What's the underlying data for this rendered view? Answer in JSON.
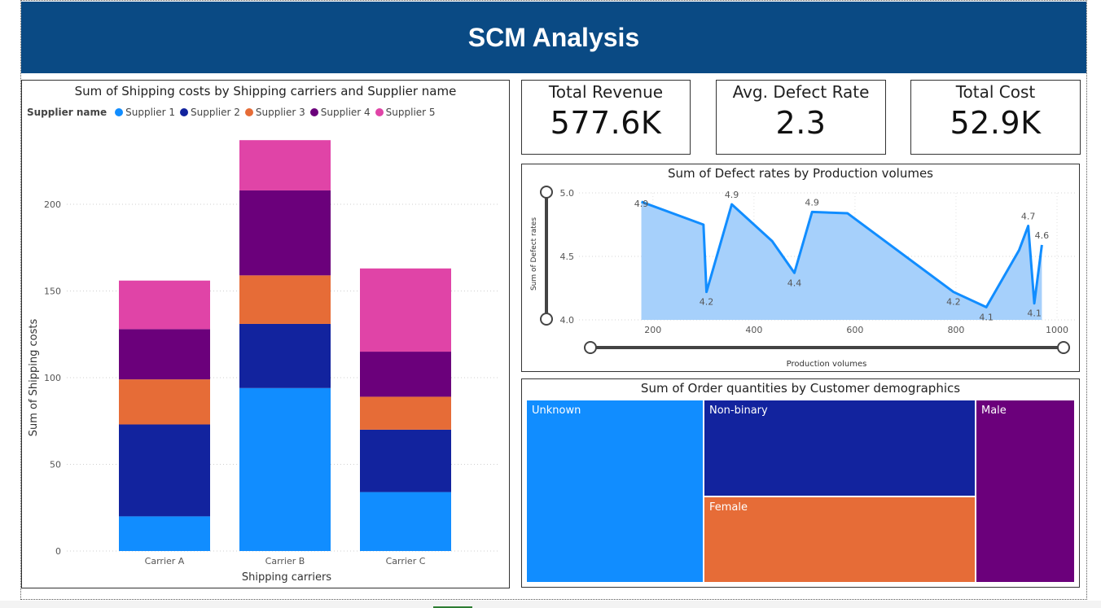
{
  "header": {
    "title": "SCM Analysis"
  },
  "kpis": [
    {
      "label": "Total Revenue",
      "value": "577.6K"
    },
    {
      "label": "Avg. Defect Rate",
      "value": "2.3"
    },
    {
      "label": "Total Cost",
      "value": "52.9K"
    }
  ],
  "bar_panel": {
    "title": "Sum of Shipping costs by Shipping carriers and Supplier name",
    "legend_title": "Supplier name"
  },
  "line_panel": {
    "title": "Sum of Defect rates by Production volumes"
  },
  "treemap_panel": {
    "title": "Sum of Order quantities by Customer demographics"
  },
  "colors": {
    "supplier_1": "#118dff",
    "supplier_2": "#12239e",
    "supplier_3": "#e66c37",
    "supplier_4": "#6b007b",
    "supplier_5": "#e044a7",
    "line": "#118dff",
    "area": "#a6d0fb",
    "header": "#0a4a84"
  },
  "chart_data": [
    {
      "type": "bar",
      "stacked": true,
      "title": "Sum of Shipping costs by Shipping carriers and Supplier name",
      "xlabel": "Shipping carriers",
      "ylabel": "Sum of Shipping costs",
      "categories": [
        "Carrier A",
        "Carrier B",
        "Carrier C"
      ],
      "ylim": [
        0,
        240
      ],
      "yticks": [
        0,
        50,
        100,
        150,
        200
      ],
      "legend_position": "top-left",
      "grid": true,
      "series": [
        {
          "name": "Supplier 1",
          "values": [
            20,
            94,
            34
          ]
        },
        {
          "name": "Supplier 2",
          "values": [
            53,
            37,
            36
          ]
        },
        {
          "name": "Supplier 3",
          "values": [
            26,
            28,
            19
          ]
        },
        {
          "name": "Supplier 4",
          "values": [
            29,
            49,
            26
          ]
        },
        {
          "name": "Supplier 5",
          "values": [
            28,
            29,
            48
          ]
        }
      ]
    },
    {
      "type": "area",
      "title": "Sum of Defect rates by Production volumes",
      "xlabel": "Production volumes",
      "ylabel": "Sum of Defect rates",
      "xlim": [
        160,
        1000
      ],
      "ylim": [
        4.0,
        5.0
      ],
      "xticks": [
        200,
        400,
        600,
        800,
        1000
      ],
      "yticks": [
        4.0,
        4.5,
        5.0
      ],
      "grid": true,
      "points": [
        {
          "x": 177,
          "y": 4.93,
          "label": "4.9"
        },
        {
          "x": 300,
          "y": 4.75
        },
        {
          "x": 306,
          "y": 4.22,
          "label": "4.2"
        },
        {
          "x": 356,
          "y": 4.91,
          "label": "4.9"
        },
        {
          "x": 436,
          "y": 4.62
        },
        {
          "x": 480,
          "y": 4.37,
          "label": "4.4"
        },
        {
          "x": 515,
          "y": 4.85,
          "label": "4.9"
        },
        {
          "x": 585,
          "y": 4.84
        },
        {
          "x": 795,
          "y": 4.22,
          "label": "4.2"
        },
        {
          "x": 860,
          "y": 4.1,
          "label": "4.1"
        },
        {
          "x": 925,
          "y": 4.55
        },
        {
          "x": 943,
          "y": 4.74,
          "label": "4.7"
        },
        {
          "x": 955,
          "y": 4.13,
          "label": "4.1"
        },
        {
          "x": 970,
          "y": 4.59,
          "label": "4.6"
        }
      ]
    },
    {
      "type": "treemap",
      "title": "Sum of Order quantities by Customer demographics",
      "items": [
        {
          "name": "Unknown",
          "value": 31
        },
        {
          "name": "Non-binary",
          "value": 25
        },
        {
          "name": "Female",
          "value": 25
        },
        {
          "name": "Male",
          "value": 19
        }
      ]
    }
  ]
}
